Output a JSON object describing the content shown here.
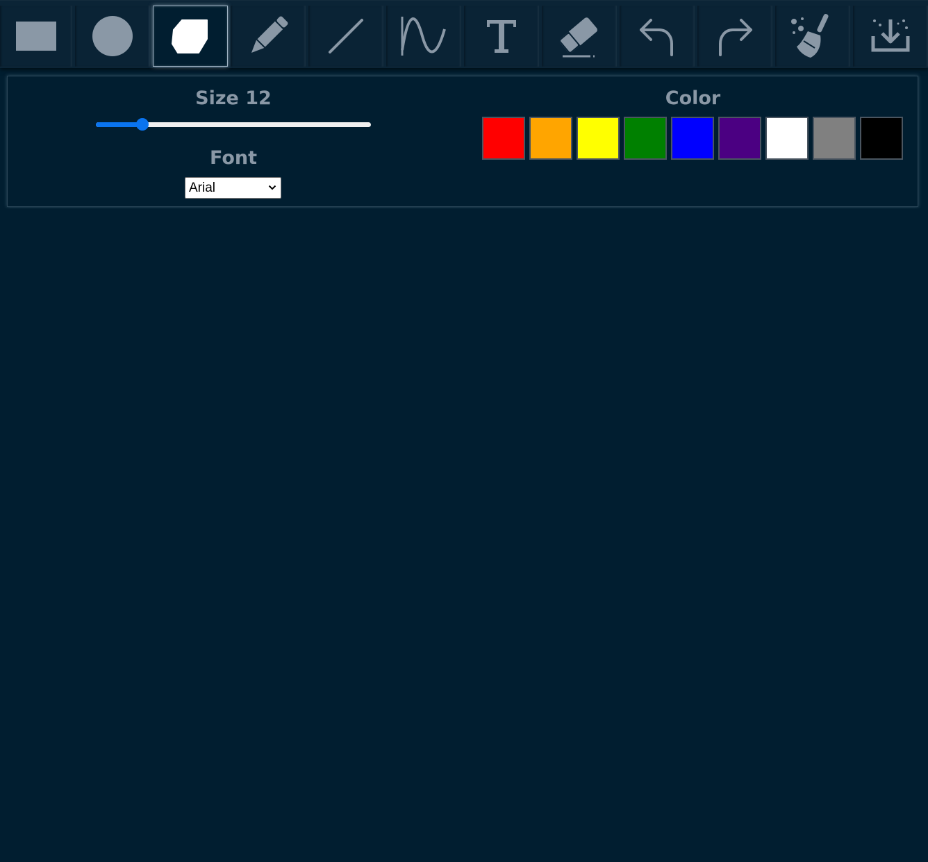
{
  "toolbar": {
    "tools": [
      {
        "name": "rectangle",
        "icon": "rectangle-icon",
        "active": false
      },
      {
        "name": "circle",
        "icon": "circle-icon",
        "active": false
      },
      {
        "name": "polygon",
        "icon": "polygon-icon",
        "active": true
      },
      {
        "name": "pencil",
        "icon": "pencil-icon",
        "active": false
      },
      {
        "name": "line",
        "icon": "line-icon",
        "active": false
      },
      {
        "name": "curve",
        "icon": "curve-icon",
        "active": false
      },
      {
        "name": "text",
        "icon": "text-icon",
        "active": false
      },
      {
        "name": "eraser",
        "icon": "eraser-icon",
        "active": false
      },
      {
        "name": "undo",
        "icon": "undo-icon",
        "active": false
      },
      {
        "name": "redo",
        "icon": "redo-icon",
        "active": false
      },
      {
        "name": "clear",
        "icon": "broom-icon",
        "active": false
      },
      {
        "name": "download",
        "icon": "download-icon",
        "active": false
      }
    ],
    "icon_color": "#8a98a6",
    "active_icon_color": "#ffffff"
  },
  "settings": {
    "size_label": "Size 12",
    "size_value": 12,
    "size_fraction": 0.17,
    "font_label": "Font",
    "font_selected": "Arial",
    "color_label": "Color",
    "colors": [
      "#ff0000",
      "#ffa500",
      "#ffff00",
      "#008000",
      "#0000ff",
      "#4b0082",
      "#ffffff",
      "#808080",
      "#000000"
    ],
    "slider_color": "#0a74ef"
  },
  "canvas": {
    "background": "#011e30"
  }
}
